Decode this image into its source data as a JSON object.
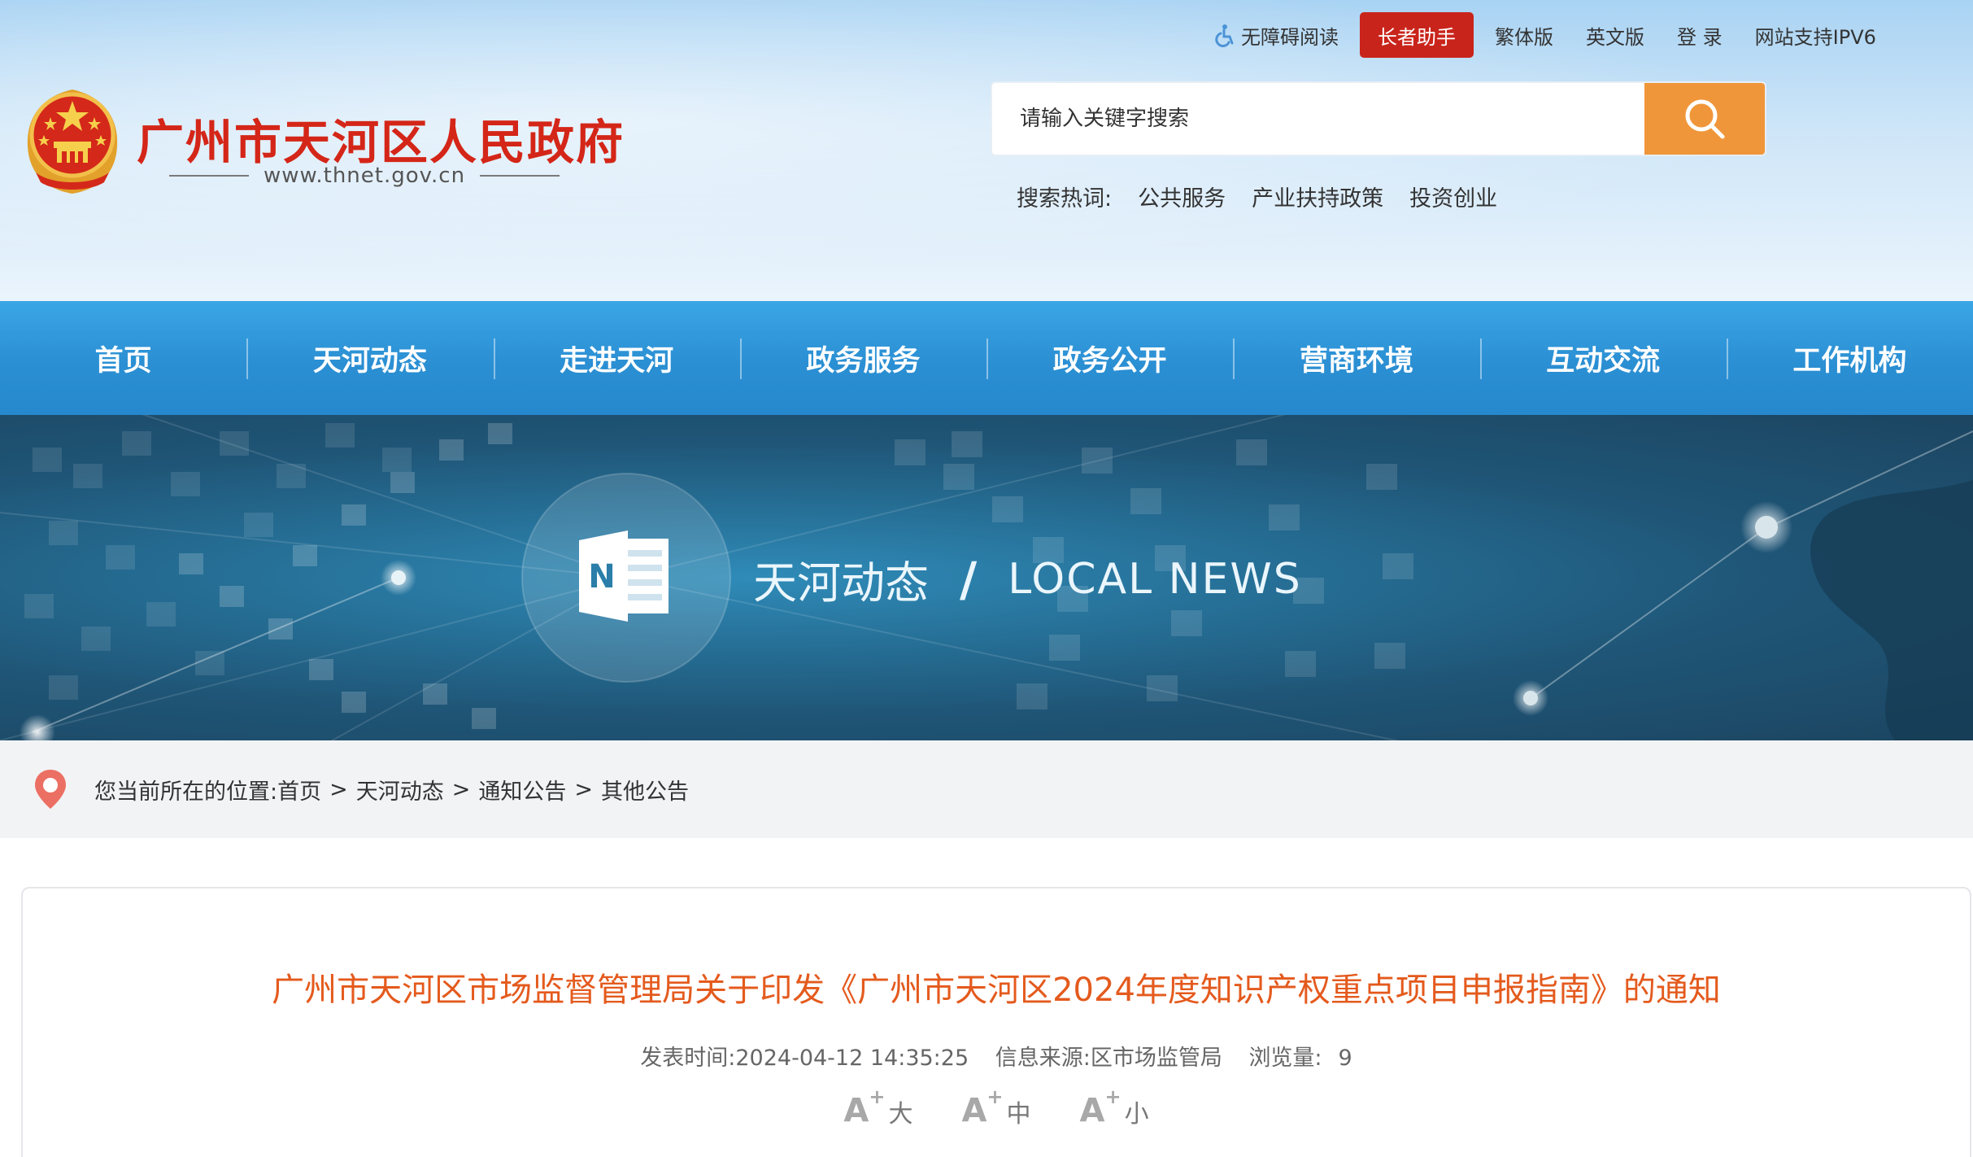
{
  "header": {
    "site_title": "广州市天河区人民政府",
    "site_url": "www.thnet.gov.cn",
    "top_links": {
      "accessibility": "无障碍阅读",
      "elder": "长者助手",
      "traditional": "繁体版",
      "english": "英文版",
      "login": "登 录",
      "ipv6": "网站支持IPV6"
    },
    "search": {
      "placeholder": "请输入关键字搜索"
    },
    "hot_words": {
      "label": "搜索热词:",
      "items": [
        "公共服务",
        "产业扶持政策",
        "投资创业"
      ]
    }
  },
  "nav": {
    "items": [
      "首页",
      "天河动态",
      "走进天河",
      "政务服务",
      "政务公开",
      "营商环境",
      "互动交流",
      "工作机构"
    ]
  },
  "banner": {
    "title_cn": "天河动态",
    "separator": "/",
    "title_en": "LOCAL NEWS",
    "icon_letter": "N"
  },
  "breadcrumb": {
    "prefix": "您当前所在的位置:",
    "items": [
      "首页",
      "天河动态",
      "通知公告",
      "其他公告"
    ],
    "separator": ">"
  },
  "article": {
    "title": "广州市天河区市场监督管理局关于印发《广州市天河区2024年度知识产权重点项目申报指南》的通知",
    "meta": {
      "publish_label": "发表时间:",
      "publish_time": "2024-04-12 14:35:25",
      "source_label": "信息来源:",
      "source": "区市场监管局",
      "views_label": "浏览量:",
      "views": "9"
    },
    "font_sizes": {
      "a_glyph": "A",
      "plus": "+",
      "large": "大",
      "medium": "中",
      "small": "小"
    }
  },
  "colors": {
    "brand_red": "#d42618",
    "nav_blue": "#2b8fd3",
    "search_orange": "#f0963a",
    "article_title": "#e45a1d"
  }
}
